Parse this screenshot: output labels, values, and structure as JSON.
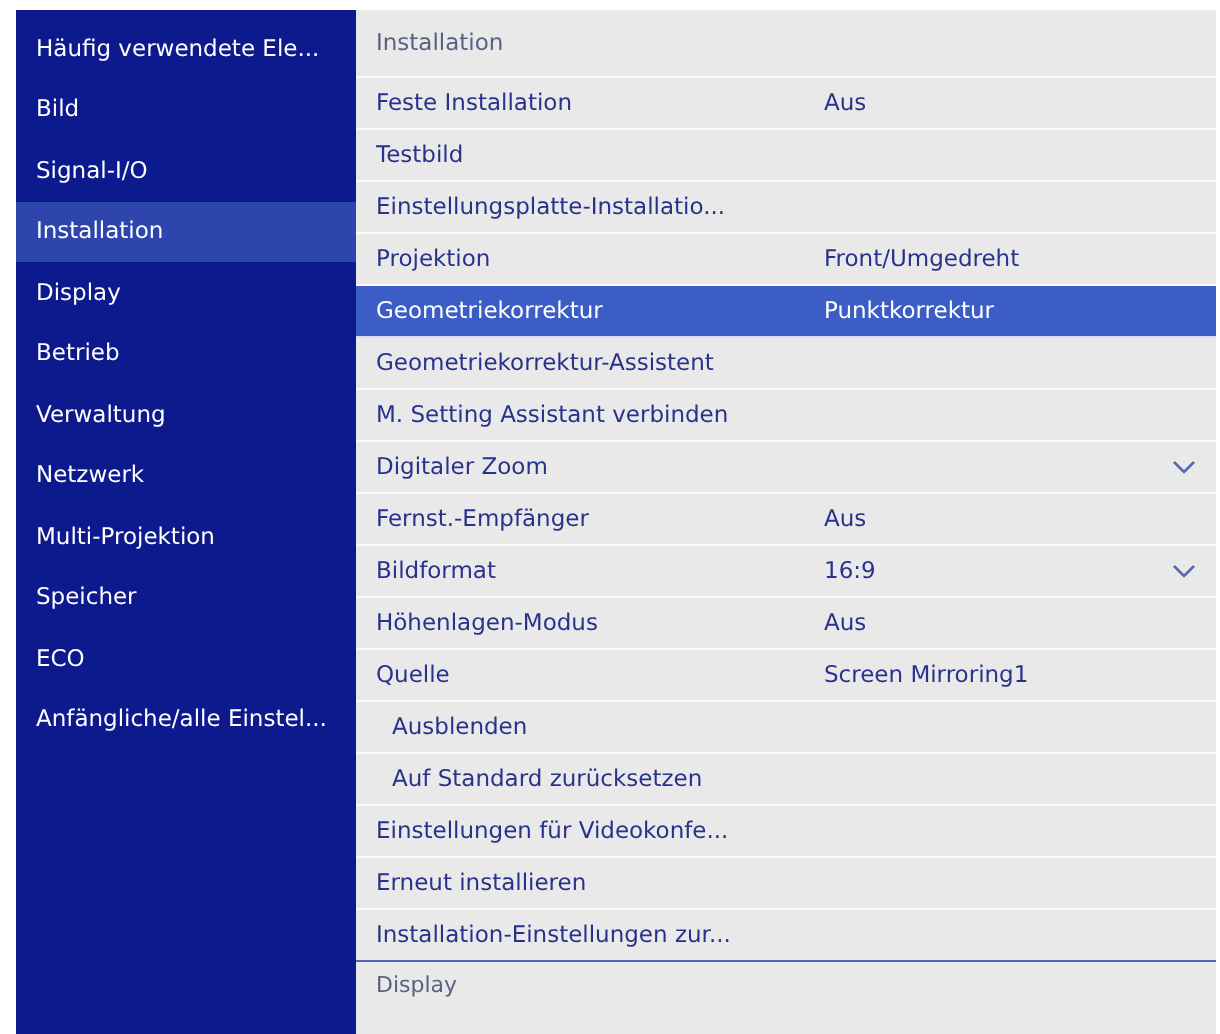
{
  "sidebar": {
    "items": [
      {
        "label": "Häufig verwendete Ele...",
        "selected": false
      },
      {
        "label": "Bild",
        "selected": false
      },
      {
        "label": "Signal-I/O",
        "selected": false
      },
      {
        "label": "Installation",
        "selected": true
      },
      {
        "label": "Display",
        "selected": false
      },
      {
        "label": "Betrieb",
        "selected": false
      },
      {
        "label": "Verwaltung",
        "selected": false
      },
      {
        "label": "Netzwerk",
        "selected": false
      },
      {
        "label": "Multi-Projektion",
        "selected": false
      },
      {
        "label": "Speicher",
        "selected": false
      },
      {
        "label": "ECO",
        "selected": false
      },
      {
        "label": "Anfängliche/alle Einstel...",
        "selected": false
      }
    ]
  },
  "panel": {
    "title": "Installation",
    "rows": [
      {
        "kind": "setting",
        "label": "Feste Installation",
        "value": "Aus",
        "selected": false
      },
      {
        "kind": "setting",
        "label": "Testbild",
        "selected": false
      },
      {
        "kind": "setting",
        "label": "Einstellungsplatte-Installatio...",
        "selected": false
      },
      {
        "kind": "setting",
        "label": "Projektion",
        "value": "Front/Umgedreht",
        "selected": false
      },
      {
        "kind": "setting",
        "label": "Geometriekorrektur",
        "value": "Punktkorrektur",
        "selected": true
      },
      {
        "kind": "setting",
        "label": "Geometriekorrektur-Assistent",
        "selected": false
      },
      {
        "kind": "setting",
        "label": "M. Setting Assistant verbinden",
        "selected": false
      },
      {
        "kind": "dropdown",
        "label": "Digitaler Zoom",
        "selected": false
      },
      {
        "kind": "setting",
        "label": "Fernst.-Empfänger",
        "value": "Aus",
        "selected": false
      },
      {
        "kind": "dropdown",
        "label": "Bildformat",
        "value": "16:9",
        "selected": false
      },
      {
        "kind": "setting",
        "label": "Höhenlagen-Modus",
        "value": "Aus",
        "selected": false
      },
      {
        "kind": "setting",
        "label": "Quelle",
        "value": "Screen Mirroring1",
        "selected": false,
        "children": [
          {
            "kind": "setting",
            "label": "Ausblenden",
            "selected": false
          },
          {
            "kind": "setting",
            "label": "Auf Standard zurücksetzen",
            "selected": false
          }
        ]
      },
      {
        "kind": "setting",
        "label": "Einstellungen für Videokonfe...",
        "selected": false
      },
      {
        "kind": "setting",
        "label": "Erneut installieren",
        "selected": false
      },
      {
        "kind": "setting",
        "label": "Installation-Einstellungen zur...",
        "selected": false
      }
    ],
    "next_section": "Display"
  }
}
